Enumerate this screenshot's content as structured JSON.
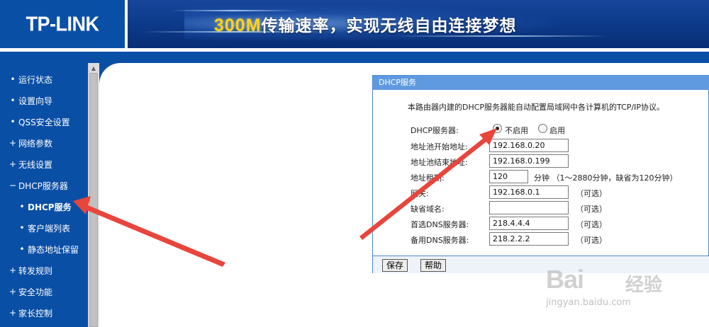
{
  "header": {
    "logo": "TP-LINK",
    "banner_speed": "300M",
    "banner_slogan": "传输速率，实现无线自由连接梦想"
  },
  "sidebar": {
    "items": [
      {
        "label": "运行状态",
        "bullet": "•"
      },
      {
        "label": "设置向导",
        "bullet": "•"
      },
      {
        "label": "QSS安全设置",
        "bullet": "•"
      },
      {
        "label": "网络参数",
        "bullet": "+"
      },
      {
        "label": "无线设置",
        "bullet": "+"
      },
      {
        "label": "DHCP服务器",
        "bullet": "−"
      },
      {
        "label": "DHCP服务",
        "bullet": "•"
      },
      {
        "label": "客户端列表",
        "bullet": "•"
      },
      {
        "label": "静态地址保留",
        "bullet": "•"
      },
      {
        "label": "转发规则",
        "bullet": "+"
      },
      {
        "label": "安全功能",
        "bullet": "+"
      },
      {
        "label": "家长控制",
        "bullet": "+"
      }
    ]
  },
  "panel": {
    "title": "DHCP服务",
    "description": "本路由器内建的DHCP服务器能自动配置局域网中各计算机的TCP/IP协议。",
    "dhcp_server": {
      "label": "DHCP服务器:",
      "option_disable": "不启用",
      "option_enable": "启用",
      "selected": "不启用"
    },
    "fields": {
      "start_ip": {
        "label": "地址池开始地址:",
        "value": "192.168.0.20"
      },
      "end_ip": {
        "label": "地址池结束地址:",
        "value": "192.168.0.199"
      },
      "lease": {
        "label": "地址租期:",
        "value": "120",
        "unit_hint": "分钟 （1～2880分钟，缺省为120分钟）"
      },
      "gateway": {
        "label": "网关:",
        "value": "192.168.0.1",
        "hint": "（可选）"
      },
      "domain": {
        "label": "缺省域名:",
        "value": "",
        "hint": "（可选）"
      },
      "primary_dns": {
        "label": "首选DNS服务器:",
        "value": "218.4.4.4",
        "hint": "（可选）"
      },
      "secondary_dns": {
        "label": "备用DNS服务器:",
        "value": "218.2.2.2",
        "hint": "（可选）"
      }
    },
    "buttons": {
      "save": "保存",
      "help": "帮助"
    }
  },
  "watermark": {
    "brand": "Bai",
    "brand_cn": "经验",
    "url": "jingyan.baidu.com"
  },
  "colors": {
    "brand_blue": "#0a4fa6",
    "panel_title": "#5f9ae0",
    "arrow_red": "#e8453c",
    "speed_yellow": "#ffd21c"
  }
}
